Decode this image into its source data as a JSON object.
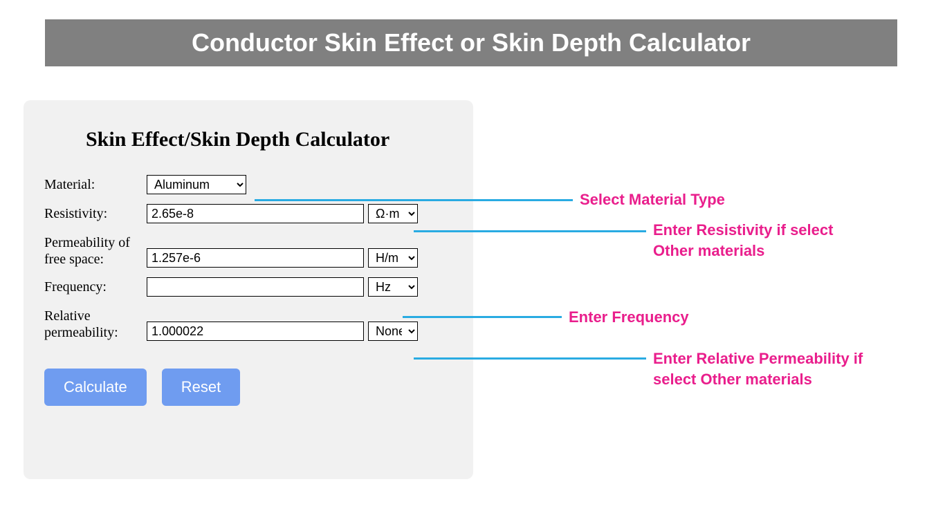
{
  "banner": {
    "title": "Conductor Skin Effect or Skin Depth Calculator"
  },
  "card": {
    "title": "Skin Effect/Skin Depth Calculator",
    "material": {
      "label": "Material:",
      "value": "Aluminum"
    },
    "resistivity": {
      "label": "Resistivity:",
      "value": "2.65e-8",
      "unit": "Ω·m"
    },
    "perm_free": {
      "label": "Permeability of free space:",
      "value": "1.257e-6",
      "unit": "H/m"
    },
    "frequency": {
      "label": "Frequency:",
      "value": "",
      "unit": "Hz"
    },
    "rel_perm": {
      "label": "Relative permeability:",
      "value": "1.000022",
      "unit": "None"
    },
    "buttons": {
      "calculate": "Calculate",
      "reset": "Reset"
    }
  },
  "annotations": {
    "material": "Select Material Type",
    "resistivity": "Enter Resistivity if select Other materials",
    "frequency": "Enter Frequency",
    "rel_perm": "Enter Relative Permeability if select Other materials"
  }
}
